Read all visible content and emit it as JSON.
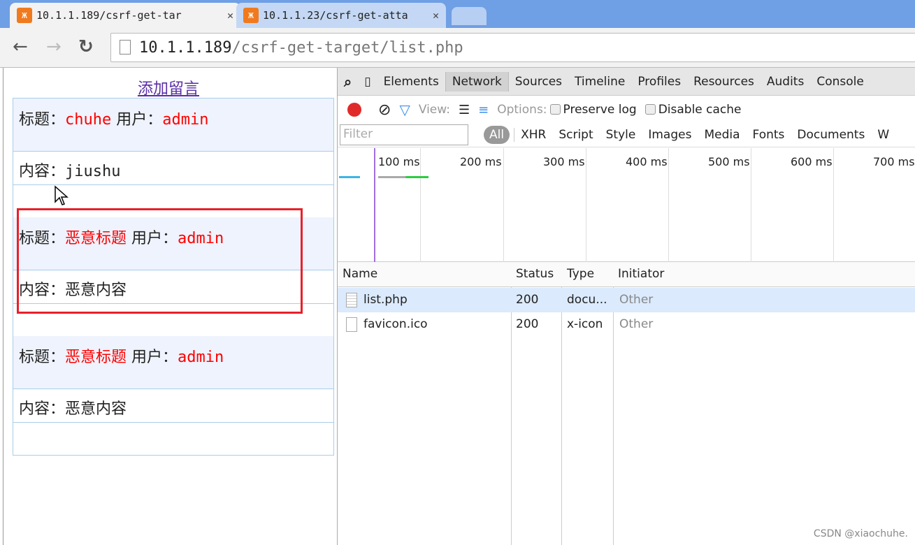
{
  "browser": {
    "tabs": [
      {
        "title": "10.1.1.189/csrf-get-tar",
        "active": true
      },
      {
        "title": "10.1.1.23/csrf-get-atta",
        "active": false
      }
    ],
    "url_host": "10.1.1.189",
    "url_path": "/csrf-get-target/list.php"
  },
  "page": {
    "add_link": "添加留言",
    "title_label": "标题：",
    "user_label": "用户：",
    "content_label": "内容：",
    "messages": [
      {
        "title": "chuhe",
        "user": "admin",
        "content": "jiushu"
      },
      {
        "title": "恶意标题",
        "user": "admin",
        "content": "恶意内容"
      },
      {
        "title": "恶意标题",
        "user": "admin",
        "content": "恶意内容"
      }
    ]
  },
  "devtools": {
    "tabs": [
      "Elements",
      "Network",
      "Sources",
      "Timeline",
      "Profiles",
      "Resources",
      "Audits",
      "Console"
    ],
    "active_tab": "Network",
    "view_label": "View:",
    "options_label": "Options:",
    "preserve_log": "Preserve log",
    "disable_cache": "Disable cache",
    "filter_placeholder": "Filter",
    "filters": [
      "All",
      "XHR",
      "Script",
      "Style",
      "Images",
      "Media",
      "Fonts",
      "Documents",
      "W"
    ],
    "timeline_ticks": [
      "100 ms",
      "200 ms",
      "300 ms",
      "400 ms",
      "500 ms",
      "600 ms",
      "700 ms"
    ],
    "columns": [
      "Name",
      "Status",
      "Type",
      "Initiator"
    ],
    "requests": [
      {
        "name": "list.php",
        "status": "200",
        "type": "docu...",
        "initiator": "Other"
      },
      {
        "name": "favicon.ico",
        "status": "200",
        "type": "x-icon",
        "initiator": "Other"
      }
    ]
  },
  "watermark": "CSDN @xiaochuhe."
}
